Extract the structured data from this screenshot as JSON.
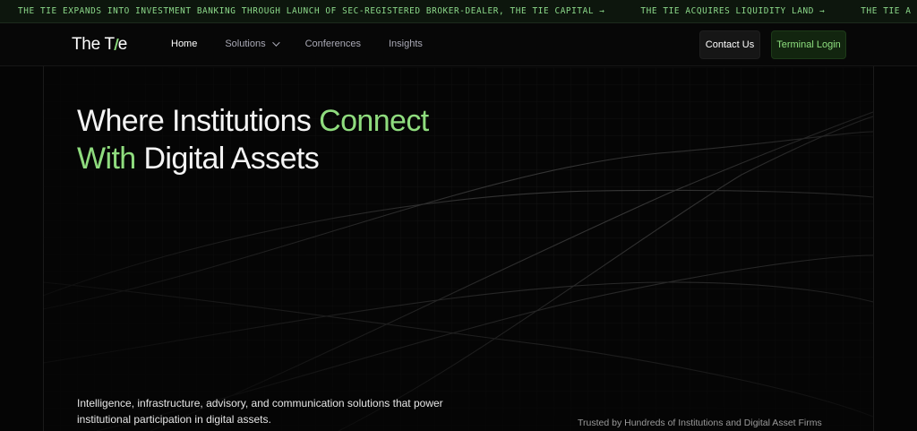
{
  "ticker": {
    "items": [
      {
        "text": "THE TIE EXPANDS INTO INVESTMENT BANKING THROUGH LAUNCH OF SEC-REGISTERED BROKER-DEALER, THE TIE CAPITAL",
        "arrow": "→"
      },
      {
        "text": "THE TIE ACQUIRES LIQUIDITY LAND",
        "arrow": "→"
      },
      {
        "text": "THE TIE A",
        "arrow": ""
      }
    ]
  },
  "header": {
    "logo_prefix": "The T",
    "logo_suffix": "e",
    "nav": [
      "Home",
      "Solutions",
      "Conferences",
      "Insights"
    ],
    "contact_label": "Contact Us",
    "terminal_label": "Terminal Login"
  },
  "hero": {
    "headline_part1": "Where Institutions ",
    "headline_accent1": "Connect",
    "headline_accent2": "With",
    "headline_part2": " Digital Assets",
    "subtext": "Intelligence, infrastructure, advisory, and communication solutions that power institutional participation in digital assets.",
    "trusted": "Trusted by Hundreds of Institutions and Digital Asset Firms"
  },
  "colors": {
    "accent": "#8fdc7e",
    "background": "#050505",
    "ticker_text": "#8cd98a"
  },
  "icons": [
    "arrow-right-icon",
    "chevron-down-icon"
  ]
}
